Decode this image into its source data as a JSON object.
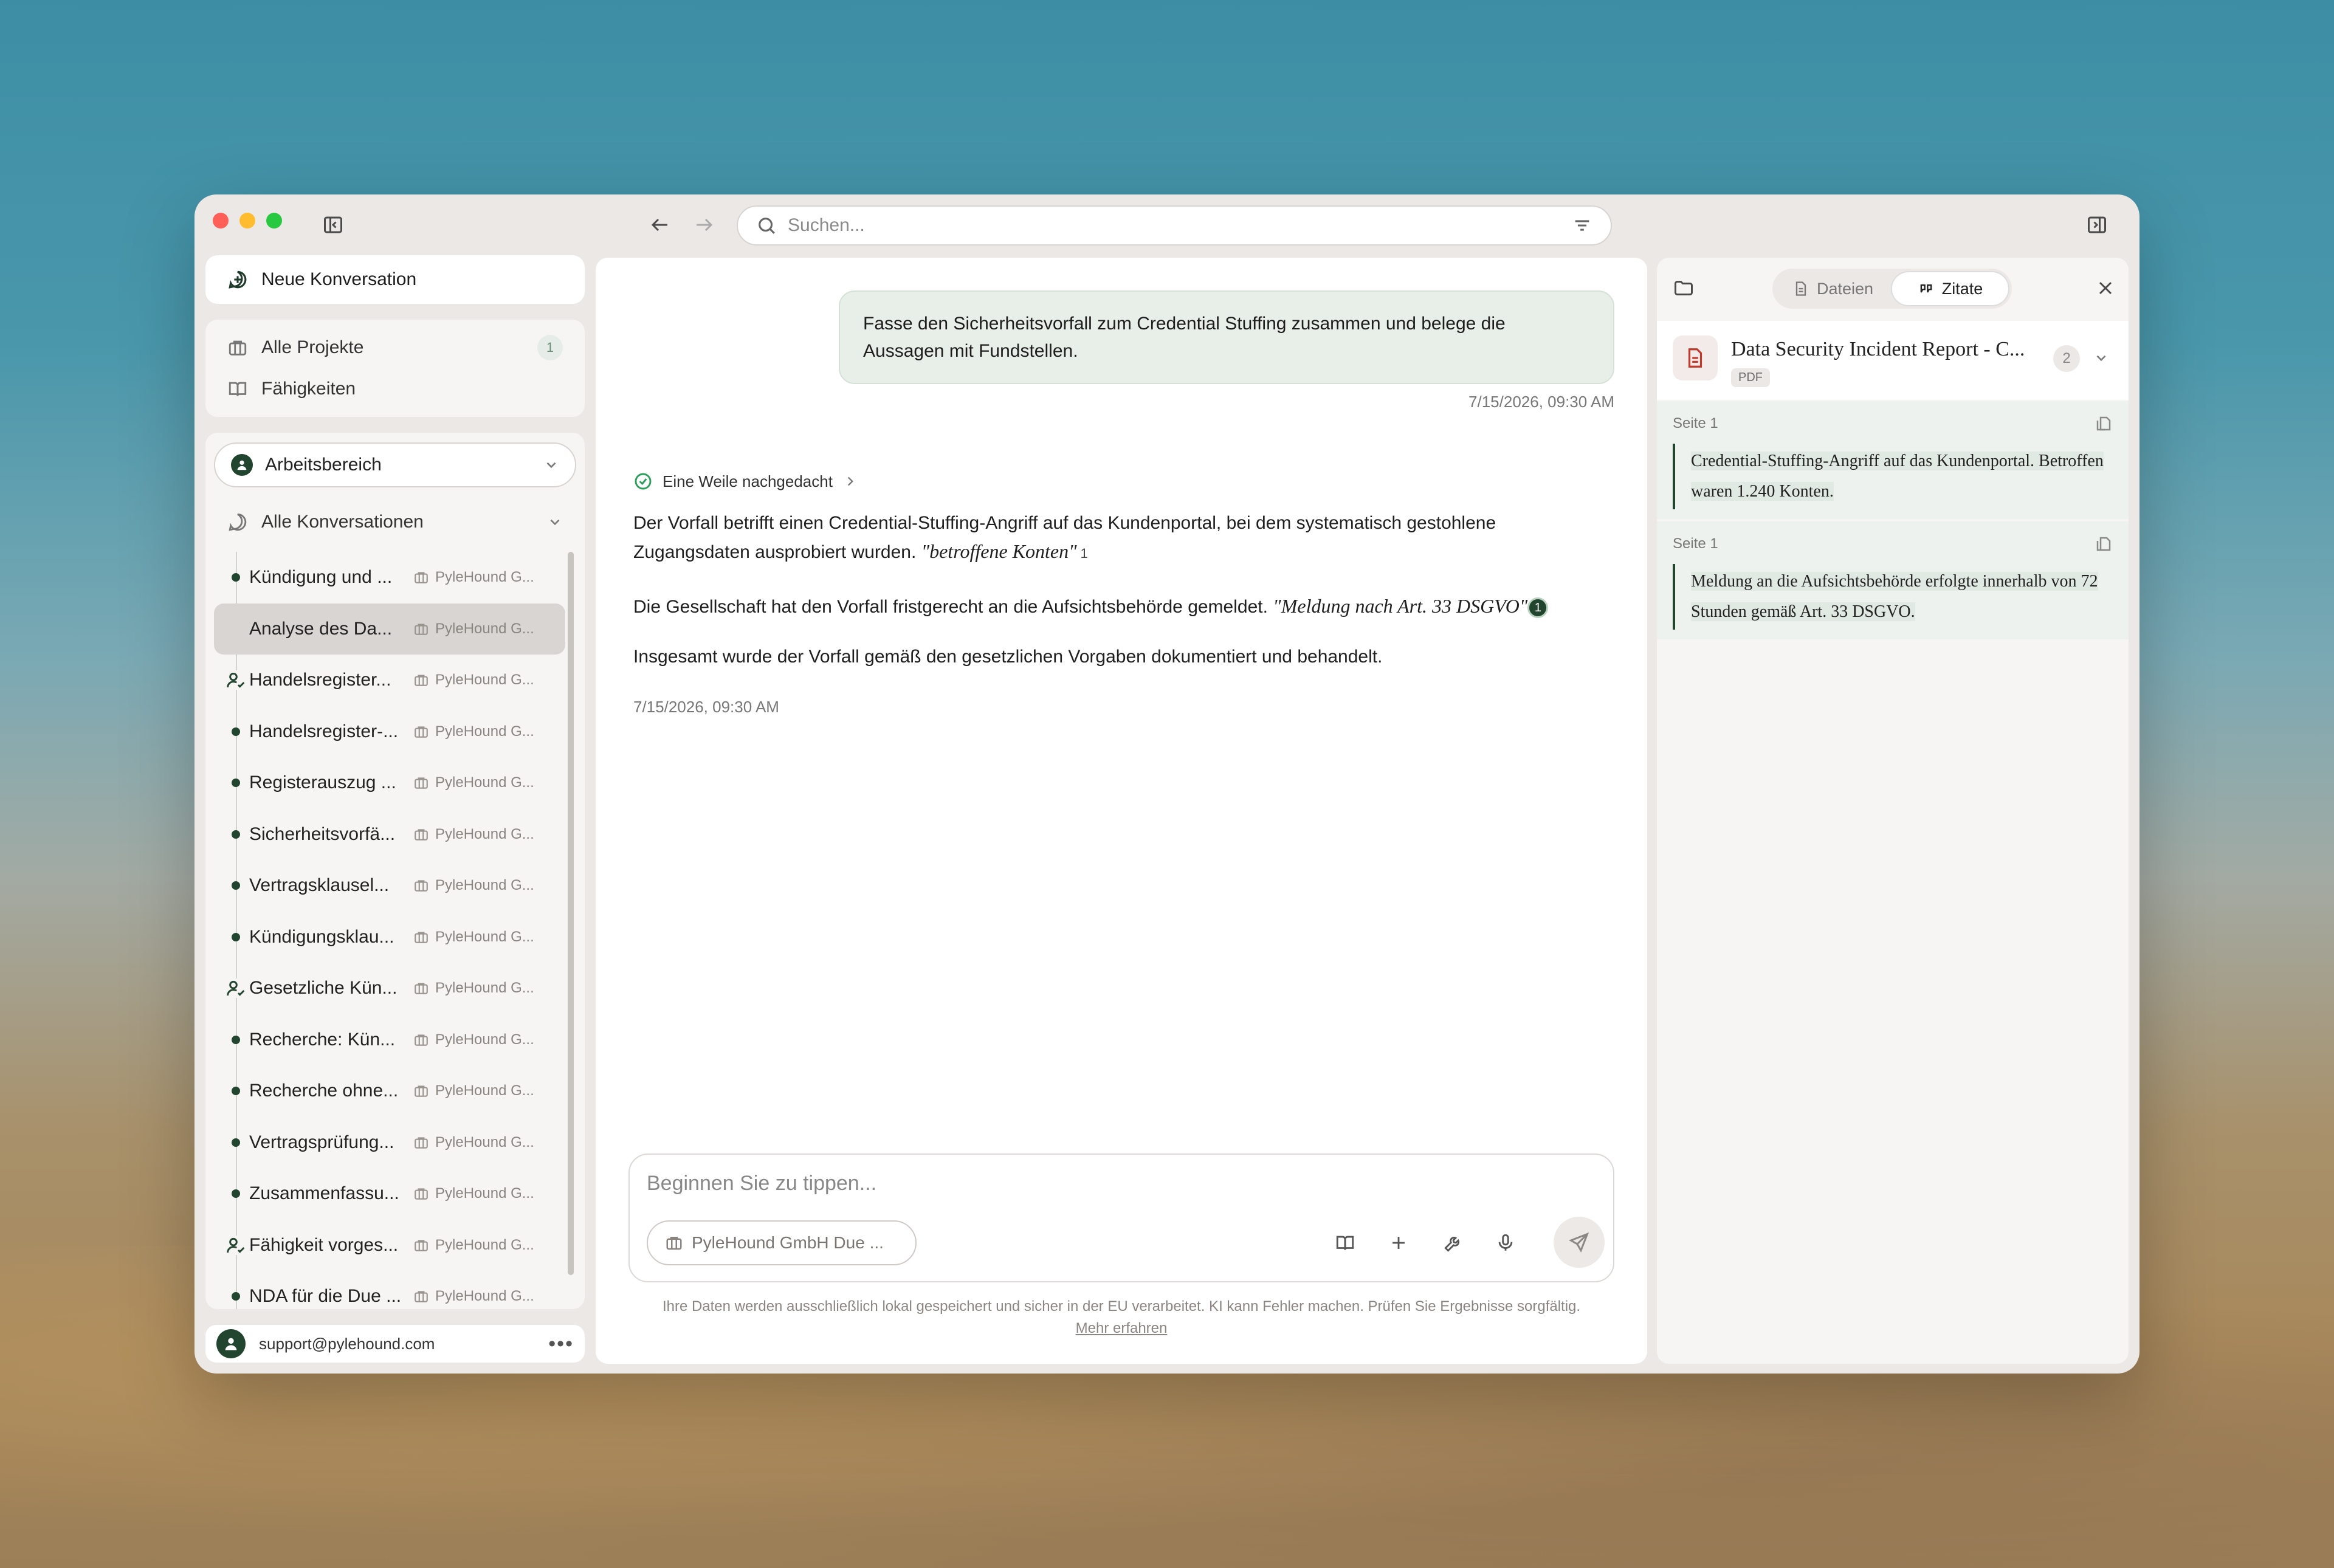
{
  "search": {
    "placeholder": "Suchen..."
  },
  "sidebar": {
    "new_conversation": "Neue Konversation",
    "nav": [
      {
        "label": "Alle Projekte",
        "badge": "1"
      },
      {
        "label": "Fähigkeiten"
      }
    ],
    "workspace": "Arbeitsbereich",
    "all_conversations": "Alle Konversationen",
    "conversations": [
      {
        "title": "Kündigung und ...",
        "project": "PyleHound G...",
        "marker": "dot"
      },
      {
        "title": "Analyse des Da...",
        "project": "PyleHound G...",
        "marker": "active"
      },
      {
        "title": "Handelsregister...",
        "project": "PyleHound G...",
        "marker": "person"
      },
      {
        "title": "Handelsregister-...",
        "project": "PyleHound G...",
        "marker": "dot"
      },
      {
        "title": "Registerauszug ...",
        "project": "PyleHound G...",
        "marker": "dot"
      },
      {
        "title": "Sicherheitsvorfä...",
        "project": "PyleHound G...",
        "marker": "dot"
      },
      {
        "title": "Vertragsklausel...",
        "project": "PyleHound G...",
        "marker": "dot"
      },
      {
        "title": "Kündigungsklau...",
        "project": "PyleHound G...",
        "marker": "dot"
      },
      {
        "title": "Gesetzliche Kün...",
        "project": "PyleHound G...",
        "marker": "person"
      },
      {
        "title": "Recherche: Kün...",
        "project": "PyleHound G...",
        "marker": "dot"
      },
      {
        "title": "Recherche ohne...",
        "project": "PyleHound G...",
        "marker": "dot"
      },
      {
        "title": "Vertragsprüfung...",
        "project": "PyleHound G...",
        "marker": "dot"
      },
      {
        "title": "Zusammenfassu...",
        "project": "PyleHound G...",
        "marker": "dot"
      },
      {
        "title": "Fähigkeit vorges...",
        "project": "PyleHound G...",
        "marker": "person"
      },
      {
        "title": "NDA für die Due ...",
        "project": "PyleHound G...",
        "marker": "dot"
      }
    ],
    "user_email": "support@pylehound.com"
  },
  "chat": {
    "user_message": "Fasse den Sicherheitsvorfall zum Credential Stuffing zusammen und belege die Aussagen mit Fundstellen.",
    "user_timestamp": "7/15/2026, 09:30 AM",
    "thought_label": "Eine Weile nachgedacht",
    "answer_p1": "Der Vorfall betrifft einen Credential-Stuffing-Angriff auf das Kundenportal, bei dem systematisch gestohlene Zugangsdaten ausprobiert wurden.",
    "answer_p1_quote": "\"betroffene Konten\"",
    "answer_p1_cite": "1",
    "answer_p2": "Die Gesellschaft hat den Vorfall fristgerecht an die Aufsichtsbehörde gemeldet.",
    "answer_p2_quote": "\"Meldung nach Art. 33 DSGVO\"",
    "answer_p2_cite": "1",
    "answer_p3": "Insgesamt wurde der Vorfall gemäß den gesetzlichen Vorgaben dokumentiert und behandelt.",
    "answer_timestamp": "7/15/2026, 09:30 AM"
  },
  "composer": {
    "placeholder": "Beginnen Sie zu tippen...",
    "project_chip": "PyleHound GmbH Due ...",
    "footnote": "Ihre Daten werden ausschließlich lokal gespeichert und sicher in der EU verarbeitet. KI kann Fehler machen. Prüfen Sie Ergebnisse sorgfältig.",
    "footnote_link": "Mehr erfahren"
  },
  "panel": {
    "tabs": [
      "Dateien",
      "Zitate"
    ],
    "active_tab": "Zitate",
    "document_title": "Data Security Incident Report - C...",
    "document_type": "PDF",
    "citation_count": "2",
    "citations": [
      {
        "page": "Seite 1",
        "text": "Credential-Stuffing-Angriff auf das Kundenportal. Betroffen waren 1.240 Konten."
      },
      {
        "page": "Seite 1",
        "text": "Meldung an die Aufsichtsbehörde erfolgte innerhalb von 72 Stunden gemäß Art. 33 DSGVO."
      }
    ]
  },
  "colors": {
    "accent": "#22452f",
    "bubble": "#e8efe9",
    "pdf": "#c0392b"
  }
}
